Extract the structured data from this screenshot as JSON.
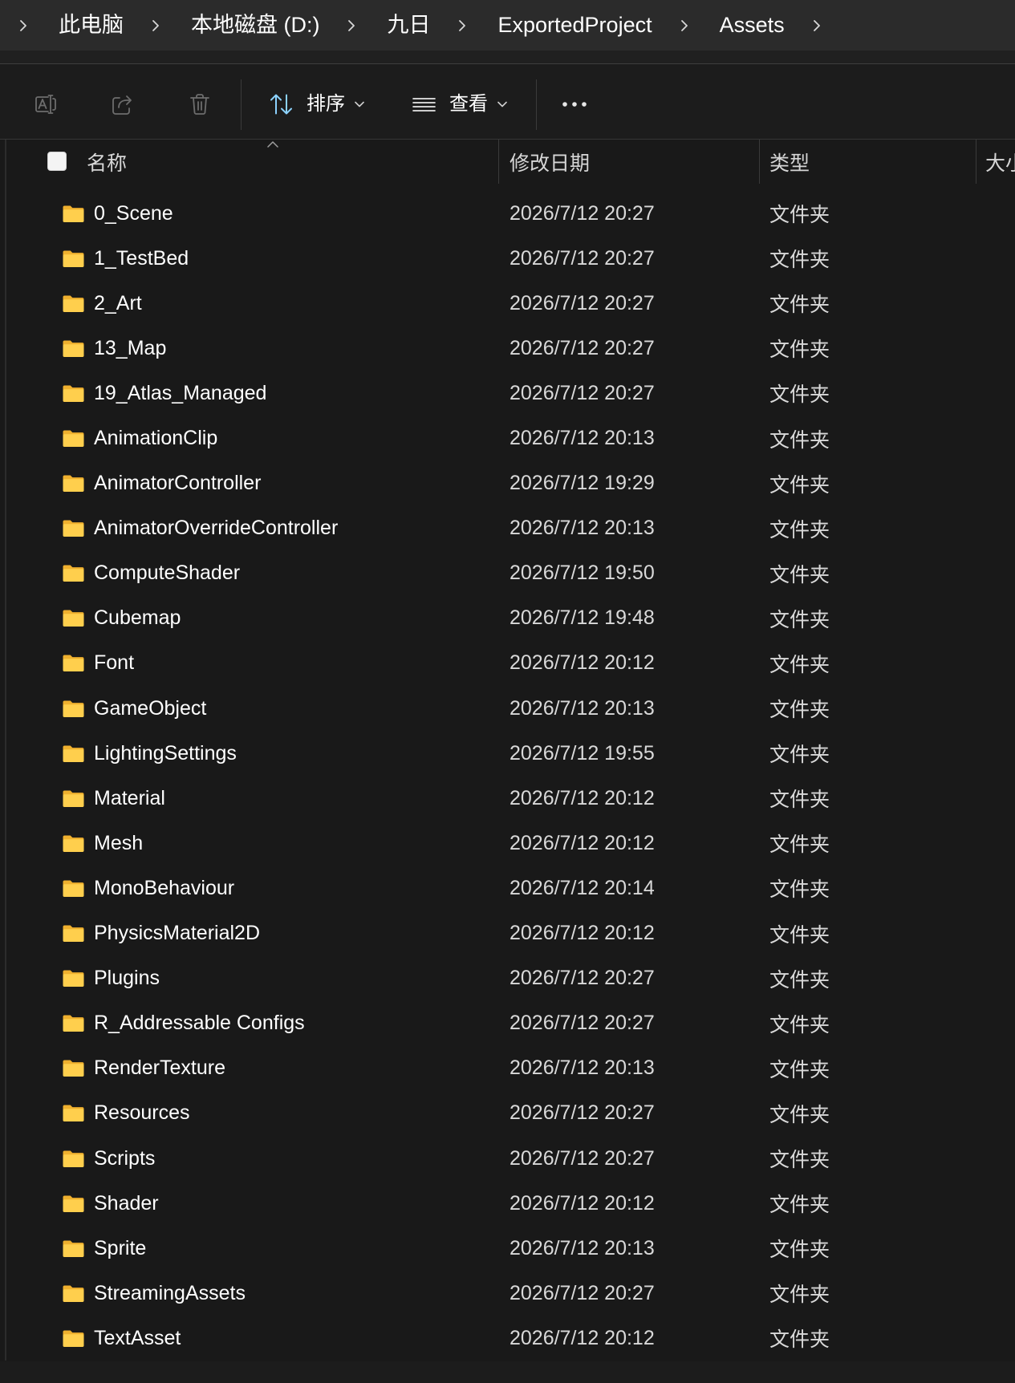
{
  "breadcrumb": {
    "separator_icon": "chevron-right-icon",
    "items": [
      {
        "label": "此电脑"
      },
      {
        "label": "本地磁盘 (D:)"
      },
      {
        "label": "九日"
      },
      {
        "label": "ExportedProject"
      },
      {
        "label": "Assets"
      }
    ]
  },
  "toolbar": {
    "rename": {
      "icon": "rename-icon",
      "enabled": false
    },
    "share": {
      "icon": "share-icon",
      "enabled": false
    },
    "delete": {
      "icon": "delete-icon",
      "enabled": false
    },
    "sort": {
      "icon": "sort-icon",
      "label": "排序",
      "dropdown_icon": "chevron-down-icon"
    },
    "view": {
      "icon": "view-icon",
      "label": "查看",
      "dropdown_icon": "chevron-down-icon"
    },
    "more": {
      "icon": "more-options-icon"
    }
  },
  "list_header": {
    "select_all_checked": false,
    "sort_indicator_icon": "sort-ascending-caret-icon",
    "columns": {
      "name": "名称",
      "modified": "修改日期",
      "type": "类型",
      "size": "大小"
    }
  },
  "files": [
    {
      "icon": "folder-icon",
      "name": "0_Scene",
      "modified": "2026/7/12 20:27",
      "type": "文件夹",
      "size": ""
    },
    {
      "icon": "folder-icon",
      "name": "1_TestBed",
      "modified": "2026/7/12 20:27",
      "type": "文件夹",
      "size": ""
    },
    {
      "icon": "folder-icon",
      "name": "2_Art",
      "modified": "2026/7/12 20:27",
      "type": "文件夹",
      "size": ""
    },
    {
      "icon": "folder-icon",
      "name": "13_Map",
      "modified": "2026/7/12 20:27",
      "type": "文件夹",
      "size": ""
    },
    {
      "icon": "folder-icon",
      "name": "19_Atlas_Managed",
      "modified": "2026/7/12 20:27",
      "type": "文件夹",
      "size": ""
    },
    {
      "icon": "folder-icon",
      "name": "AnimationClip",
      "modified": "2026/7/12 20:13",
      "type": "文件夹",
      "size": ""
    },
    {
      "icon": "folder-icon",
      "name": "AnimatorController",
      "modified": "2026/7/12 19:29",
      "type": "文件夹",
      "size": ""
    },
    {
      "icon": "folder-icon",
      "name": "AnimatorOverrideController",
      "modified": "2026/7/12 20:13",
      "type": "文件夹",
      "size": ""
    },
    {
      "icon": "folder-icon",
      "name": "ComputeShader",
      "modified": "2026/7/12 19:50",
      "type": "文件夹",
      "size": ""
    },
    {
      "icon": "folder-icon",
      "name": "Cubemap",
      "modified": "2026/7/12 19:48",
      "type": "文件夹",
      "size": ""
    },
    {
      "icon": "folder-icon",
      "name": "Font",
      "modified": "2026/7/12 20:12",
      "type": "文件夹",
      "size": ""
    },
    {
      "icon": "folder-icon",
      "name": "GameObject",
      "modified": "2026/7/12 20:13",
      "type": "文件夹",
      "size": ""
    },
    {
      "icon": "folder-icon",
      "name": "LightingSettings",
      "modified": "2026/7/12 19:55",
      "type": "文件夹",
      "size": ""
    },
    {
      "icon": "folder-icon",
      "name": "Material",
      "modified": "2026/7/12 20:12",
      "type": "文件夹",
      "size": ""
    },
    {
      "icon": "folder-icon",
      "name": "Mesh",
      "modified": "2026/7/12 20:12",
      "type": "文件夹",
      "size": ""
    },
    {
      "icon": "folder-icon",
      "name": "MonoBehaviour",
      "modified": "2026/7/12 20:14",
      "type": "文件夹",
      "size": ""
    },
    {
      "icon": "folder-icon",
      "name": "PhysicsMaterial2D",
      "modified": "2026/7/12 20:12",
      "type": "文件夹",
      "size": ""
    },
    {
      "icon": "folder-icon",
      "name": "Plugins",
      "modified": "2026/7/12 20:27",
      "type": "文件夹",
      "size": ""
    },
    {
      "icon": "folder-icon",
      "name": "R_Addressable Configs",
      "modified": "2026/7/12 20:27",
      "type": "文件夹",
      "size": ""
    },
    {
      "icon": "folder-icon",
      "name": "RenderTexture",
      "modified": "2026/7/12 20:13",
      "type": "文件夹",
      "size": ""
    },
    {
      "icon": "folder-icon",
      "name": "Resources",
      "modified": "2026/7/12 20:27",
      "type": "文件夹",
      "size": ""
    },
    {
      "icon": "folder-icon",
      "name": "Scripts",
      "modified": "2026/7/12 20:27",
      "type": "文件夹",
      "size": ""
    },
    {
      "icon": "folder-icon",
      "name": "Shader",
      "modified": "2026/7/12 20:12",
      "type": "文件夹",
      "size": ""
    },
    {
      "icon": "folder-icon",
      "name": "Sprite",
      "modified": "2026/7/12 20:13",
      "type": "文件夹",
      "size": ""
    },
    {
      "icon": "folder-icon",
      "name": "StreamingAssets",
      "modified": "2026/7/12 20:27",
      "type": "文件夹",
      "size": ""
    },
    {
      "icon": "folder-icon",
      "name": "TextAsset",
      "modified": "2026/7/12 20:12",
      "type": "文件夹",
      "size": ""
    }
  ],
  "colors": {
    "folder_front": "#ffcf4d",
    "folder_back": "#efb02e",
    "sort_accent": "#8cd2ff"
  }
}
